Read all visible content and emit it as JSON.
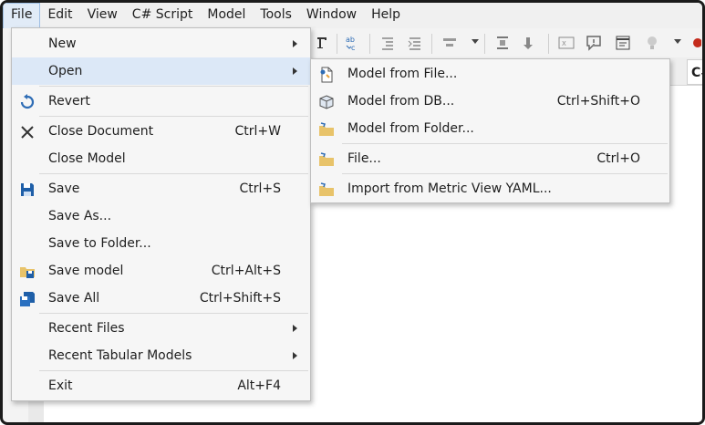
{
  "menubar": {
    "items": [
      {
        "label": "File",
        "active": true
      },
      {
        "label": "Edit"
      },
      {
        "label": "View"
      },
      {
        "label": "C# Script"
      },
      {
        "label": "Model"
      },
      {
        "label": "Tools"
      },
      {
        "label": "Window"
      },
      {
        "label": "Help"
      }
    ]
  },
  "background": {
    "tab_label": "C#"
  },
  "file_menu": {
    "new": "New",
    "open": "Open",
    "revert": "Revert",
    "close_document": "Close Document",
    "close_document_shortcut": "Ctrl+W",
    "close_model": "Close Model",
    "save": "Save",
    "save_shortcut": "Ctrl+S",
    "save_as": "Save As...",
    "save_to_folder": "Save to Folder...",
    "save_model": "Save model",
    "save_model_shortcut": "Ctrl+Alt+S",
    "save_all": "Save All",
    "save_all_shortcut": "Ctrl+Shift+S",
    "recent_files": "Recent Files",
    "recent_tabular_models": "Recent Tabular Models",
    "exit": "Exit",
    "exit_shortcut": "Alt+F4"
  },
  "open_menu": {
    "model_from_file": "Model from File...",
    "model_from_db": "Model from DB...",
    "model_from_db_shortcut": "Ctrl+Shift+O",
    "model_from_folder": "Model from Folder...",
    "file": "File...",
    "file_shortcut": "Ctrl+O",
    "import_metric_view": "Import from Metric View YAML..."
  },
  "colors": {
    "highlight": "#dce8f7",
    "menu_bg": "#f6f6f6",
    "save_blue": "#1f5fa8",
    "folder_yellow": "#e8c36a",
    "refresh_blue": "#2f6db5"
  }
}
